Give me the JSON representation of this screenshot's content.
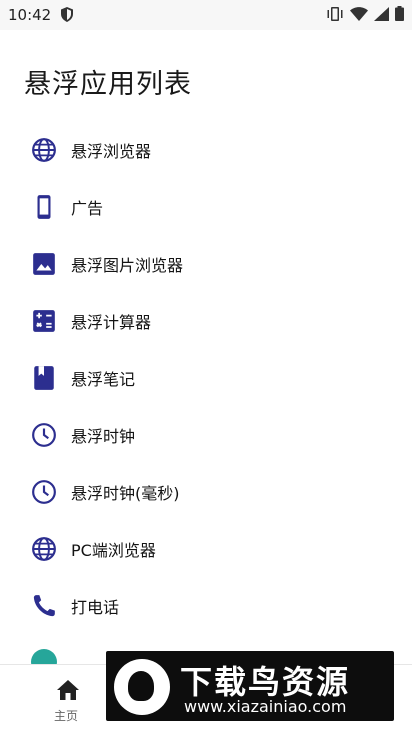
{
  "status_bar": {
    "time": "10:42",
    "icons": [
      "shield-icon",
      "vibrate-icon",
      "wifi-icon",
      "signal-icon",
      "battery-icon"
    ]
  },
  "page": {
    "title": "悬浮应用列表"
  },
  "app_list": {
    "items": [
      {
        "label": "悬浮浏览器",
        "icon": "globe-icon"
      },
      {
        "label": "广告",
        "icon": "phone-device-icon"
      },
      {
        "label": "悬浮图片浏览器",
        "icon": "image-icon"
      },
      {
        "label": "悬浮计算器",
        "icon": "calculator-icon"
      },
      {
        "label": "悬浮笔记",
        "icon": "book-icon"
      },
      {
        "label": "悬浮时钟",
        "icon": "clock-icon"
      },
      {
        "label": "悬浮时钟(毫秒)",
        "icon": "clock-icon"
      },
      {
        "label": "PC端浏览器",
        "icon": "globe-icon"
      },
      {
        "label": "打电话",
        "icon": "phone-call-icon"
      }
    ]
  },
  "bottom_nav": {
    "home_label": "主页"
  },
  "watermark": {
    "title": "下载鸟资源",
    "url": "www.xiazainiao.com"
  },
  "colors": {
    "icon_accent": "#2c2e8f",
    "teal": "#26a69a"
  }
}
